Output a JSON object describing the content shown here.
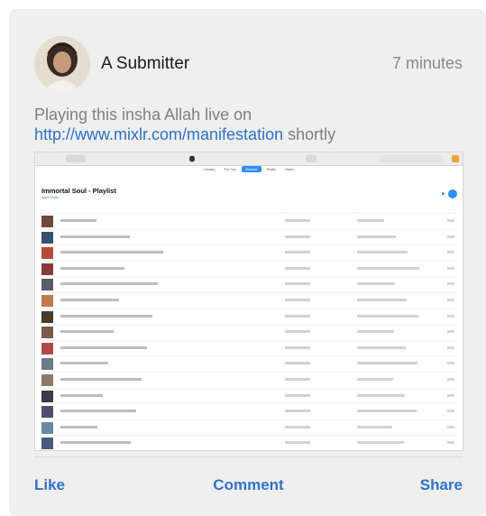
{
  "post": {
    "author": "A Submitter",
    "time": "7 minutes",
    "text_before": "Playing this insha Allah live on",
    "link": "http://www.mixlr.com/manifestation",
    "text_after": " shortly"
  },
  "screenshot": {
    "tabs": [
      "Library",
      "For You",
      "Browse",
      "Radio",
      "Store"
    ],
    "active_tab": "Browse",
    "playlist_title": "Immortal Soul - Playlist",
    "playlist_subtitle": "Apple Music",
    "rows": 15,
    "thumb_colors": [
      "#6b4a3a",
      "#3a4f6e",
      "#b84a3a",
      "#8a3a3a",
      "#5a5a6a",
      "#c07a4a",
      "#4a3a2a",
      "#7a5a4a",
      "#b04a4a",
      "#6a7a8a",
      "#8a7a6a",
      "#3a3a4a",
      "#5a4a6a",
      "#6a8aa0",
      "#4a5a7a"
    ]
  },
  "actions": {
    "like": "Like",
    "comment": "Comment",
    "share": "Share"
  }
}
